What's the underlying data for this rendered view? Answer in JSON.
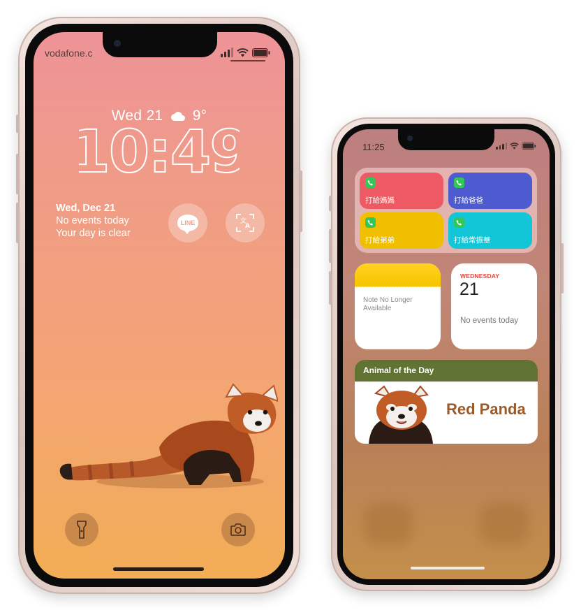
{
  "lock_screen": {
    "carrier": "vodafone.c",
    "date_weather": "Wed 21",
    "temperature": "9°",
    "time": "10:49",
    "calendar_widget": {
      "date": "Wed, Dec 21",
      "events": "No events today",
      "status": "Your day is clear"
    },
    "line_widget_label": "LINE",
    "icons": [
      "cloud-icon",
      "line-app-icon",
      "translate-icon",
      "flashlight-icon",
      "camera-icon"
    ]
  },
  "home_screen": {
    "time": "11:25",
    "contacts": [
      {
        "label": "打給媽媽",
        "color": "#ee5a63"
      },
      {
        "label": "打給爸爸",
        "color": "#4e5bd0"
      },
      {
        "label": "打給弟弟",
        "color": "#f0c000"
      },
      {
        "label": "打給常振華",
        "color": "#12c6d8"
      }
    ],
    "note_widget": {
      "text": "Note No Longer Available"
    },
    "calendar_widget": {
      "weekday": "WEDNESDAY",
      "day": "21",
      "events": "No events today"
    },
    "animal_widget": {
      "header": "Animal of the Day",
      "name": "Red Panda"
    }
  }
}
